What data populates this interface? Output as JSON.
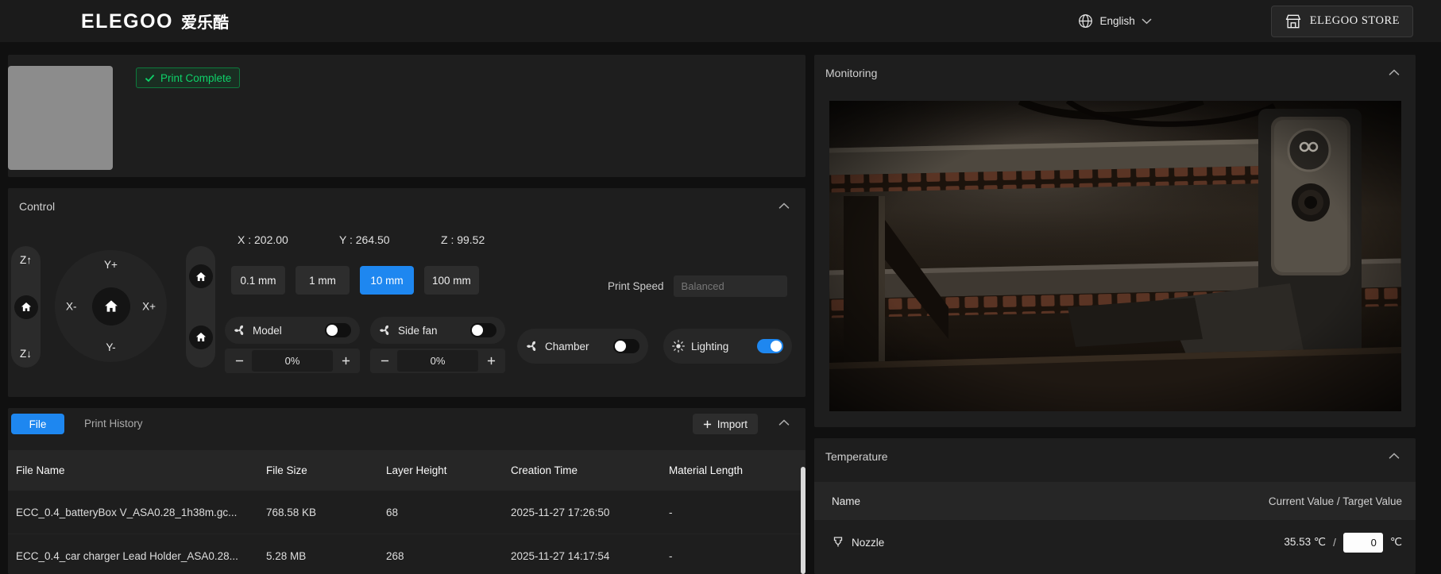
{
  "colors": {
    "accent_blue": "#1e87f0",
    "success_green": "#0ed269",
    "panel_bg": "#1e1e1e"
  },
  "topbar": {
    "logo_text": "ELEGOO",
    "logo_cn": "爱乐酷",
    "language_label": "English",
    "store_label": "ELEGOO STORE"
  },
  "status_panel": {
    "badge_label": "Print Complete"
  },
  "control_panel": {
    "title": "Control",
    "jog": {
      "z_up": "Z↑",
      "z_down": "Z↓",
      "y_plus": "Y+",
      "y_minus": "Y-",
      "x_plus": "X+",
      "x_minus": "X-"
    },
    "position": {
      "x": "X : 202.00",
      "y": "Y : 264.50",
      "z": "Z : 99.52"
    },
    "steps": [
      "0.1 mm",
      "1 mm",
      "10 mm",
      "100 mm"
    ],
    "selected_step": "10 mm",
    "print_speed_label": "Print Speed",
    "print_speed_value": "Balanced",
    "fans": {
      "model": {
        "label": "Model",
        "on": false,
        "value": "0%"
      },
      "side": {
        "label": "Side fan",
        "on": false,
        "value": "0%"
      },
      "chamber": {
        "label": "Chamber",
        "on": false
      },
      "lighting": {
        "label": "Lighting",
        "on": true
      }
    }
  },
  "file_panel": {
    "tab_file": "File",
    "tab_history": "Print History",
    "import_label": "Import",
    "columns": [
      "File Name",
      "File Size",
      "Layer Height",
      "Creation Time",
      "Material Length"
    ],
    "rows": [
      {
        "name": "ECC_0.4_batteryBox V_ASA0.28_1h38m.gc...",
        "size": "768.58 KB",
        "layers": "68",
        "created": "2025-11-27 17:26:50",
        "material": "-"
      },
      {
        "name": "ECC_0.4_car charger Lead Holder_ASA0.28...",
        "size": "5.28 MB",
        "layers": "268",
        "created": "2025-11-27 14:17:54",
        "material": "-"
      }
    ]
  },
  "monitoring_panel": {
    "title": "Monitoring"
  },
  "temperature_panel": {
    "title": "Temperature",
    "name_column": "Name",
    "value_column": "Current Value / Target Value",
    "rows": [
      {
        "name": "Nozzle",
        "current": "35.53 ℃",
        "separator": "/",
        "target": "0",
        "unit": "℃"
      }
    ]
  }
}
